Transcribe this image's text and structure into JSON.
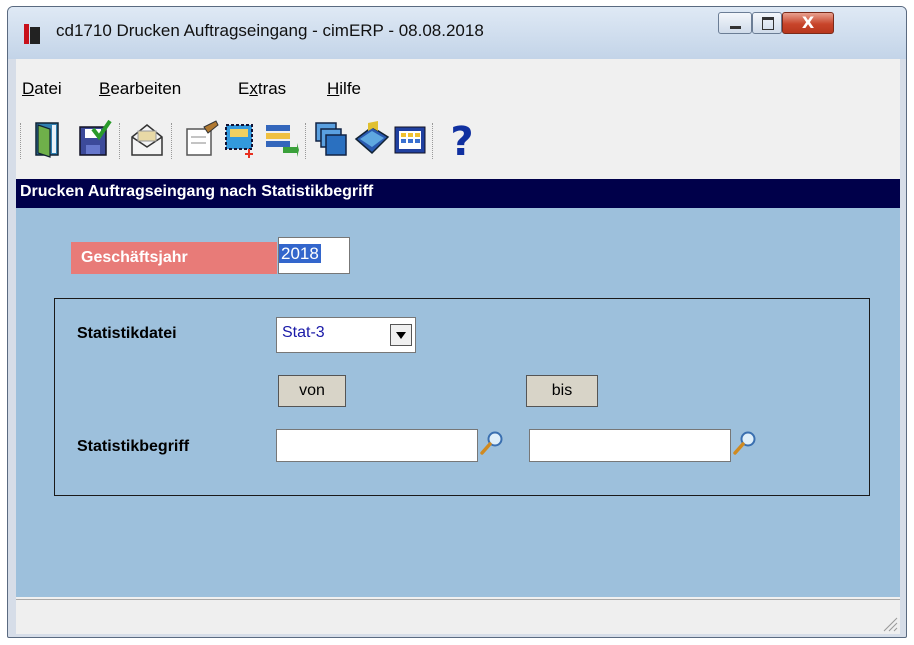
{
  "window": {
    "title": "cd1710 Drucken Auftragseingang - cimERP - 08.08.2018",
    "controls": {
      "minimize_icon": "minimize-icon",
      "maximize_icon": "maximize-icon",
      "close_label": "X"
    }
  },
  "menu": {
    "items": [
      {
        "label": "Datei",
        "underline": "D",
        "rest": "atei"
      },
      {
        "label": "Bearbeiten",
        "underline": "B",
        "rest": "earbeiten"
      },
      {
        "label": "Extras",
        "pre": "E",
        "underline": "x",
        "rest": "tras"
      },
      {
        "label": "Hilfe",
        "underline": "H",
        "rest": "ilfe"
      }
    ]
  },
  "toolbar": {
    "icons": [
      "exit-door-icon",
      "save-icon",
      "mail-icon",
      "edit-form-icon",
      "new-selection-icon",
      "transfer-list-icon",
      "windows-icon",
      "book-icon",
      "grid-icon",
      "help-icon"
    ]
  },
  "form": {
    "header": "Drucken Auftragseingang nach Statistikbegriff",
    "geschaeftsjahr_label": "Geschäftsjahr",
    "geschaeftsjahr_value": "2018",
    "statistikdatei_label": "Statistikdatei",
    "statistikdatei_value": "Stat-3",
    "von_label": "von",
    "bis_label": "bis",
    "statistikbegriff_label": "Statistikbegriff",
    "statistikbegriff_von": "",
    "statistikbegriff_bis": ""
  },
  "colors": {
    "header_bg": "#00004a",
    "panel_bg": "#9dc0dc",
    "required_label_bg": "#e87b78",
    "selection": "#3366cc"
  }
}
